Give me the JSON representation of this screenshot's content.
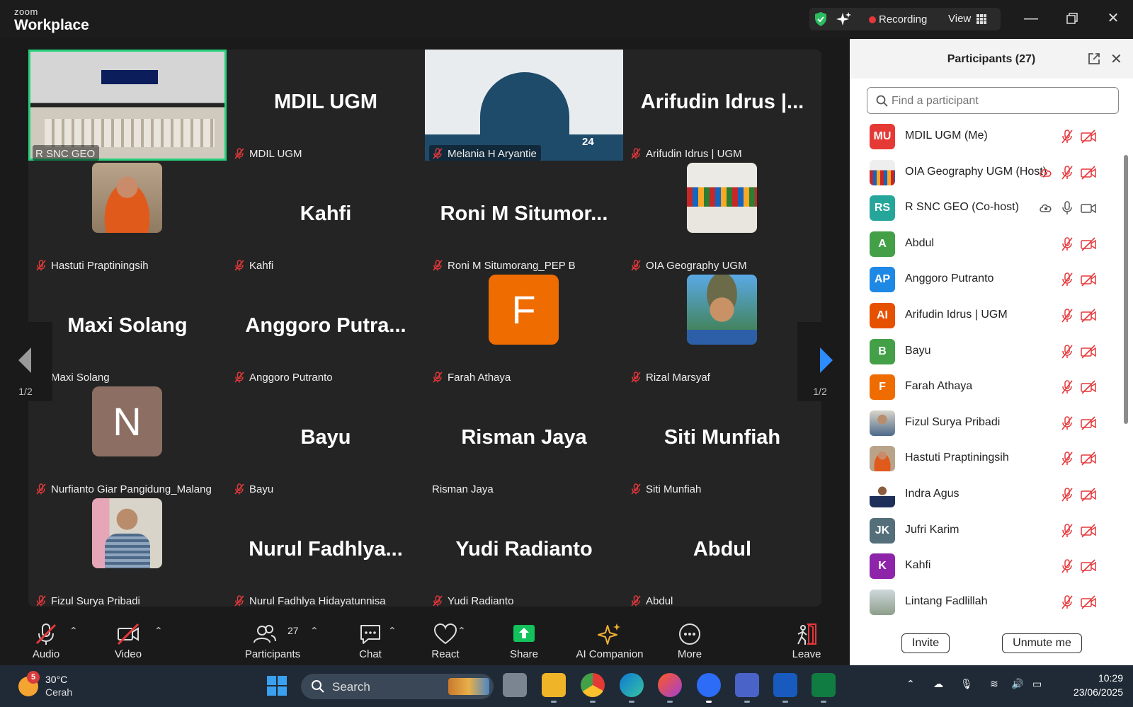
{
  "titlebar": {
    "brand_small": "zoom",
    "brand_big": "Workplace",
    "recording_label": "Recording",
    "view_label": "View"
  },
  "grid": {
    "page_left": "1/2",
    "page_right": "1/2",
    "tiles": [
      {
        "name": "R SNC GEO",
        "kind": "room",
        "muted": false,
        "active": true
      },
      {
        "name": "MDIL UGM",
        "display": "MDIL UGM",
        "kind": "text",
        "muted": true
      },
      {
        "name": "Melania H Aryantie",
        "kind": "slide",
        "muted": true
      },
      {
        "name": "Arifudin Idrus | UGM",
        "display": "Arifudin Idrus |...",
        "kind": "text",
        "muted": true
      },
      {
        "name": "Hastuti Praptiningsih",
        "kind": "photo-orange",
        "muted": true
      },
      {
        "name": "Kahfi",
        "display": "Kahfi",
        "kind": "text",
        "muted": true
      },
      {
        "name": "Roni M Situmorang_PEP B",
        "display": "Roni M Situmor...",
        "kind": "text",
        "muted": true
      },
      {
        "name": "OIA Geography UGM",
        "kind": "photo-flags",
        "muted": true
      },
      {
        "name": "Maxi Solang",
        "display": "Maxi Solang",
        "kind": "text",
        "muted": true
      },
      {
        "name": "Anggoro Putranto",
        "display": "Anggoro Putra...",
        "kind": "text",
        "muted": true
      },
      {
        "name": "Farah Athaya",
        "kind": "letter",
        "letter": "F",
        "color": "#ef6c00",
        "muted": true
      },
      {
        "name": "Rizal Marsyaf",
        "kind": "photo-hat",
        "muted": true
      },
      {
        "name": "Nurfianto Giar Pangidung_Malang",
        "kind": "letter",
        "letter": "N",
        "color": "#8d6e63",
        "muted": true
      },
      {
        "name": "Bayu",
        "display": "Bayu",
        "kind": "text",
        "muted": true
      },
      {
        "name": "Risman Jaya",
        "display": "Risman Jaya",
        "kind": "text",
        "muted": false
      },
      {
        "name": "Siti Munfiah",
        "display": "Siti Munfiah",
        "kind": "text",
        "muted": true
      },
      {
        "name": "Fizul Surya Pribadi",
        "kind": "photo-man",
        "muted": true
      },
      {
        "name": "Nurul Fadhlya Hidayatunnisa",
        "display": "Nurul Fadhlya...",
        "kind": "text",
        "muted": true
      },
      {
        "name": "Yudi Radianto",
        "display": "Yudi Radianto",
        "kind": "text",
        "muted": true
      },
      {
        "name": "Abdul",
        "display": "Abdul",
        "kind": "text",
        "muted": true
      }
    ],
    "slide": {
      "date_number": "24"
    }
  },
  "panel": {
    "title": "Participants (27)",
    "search_placeholder": "Find a participant",
    "invite_label": "Invite",
    "unmute_label": "Unmute me",
    "participants": [
      {
        "name": "MDIL UGM (Me)",
        "initials": "MU",
        "color": "#e53935",
        "cloud": false,
        "mic_on": false,
        "video_on": false
      },
      {
        "name": "OIA Geography UGM (Host)",
        "initials": "",
        "photo": "flags",
        "cloud": true,
        "cloud_red": true,
        "mic_on": false,
        "video_on": false
      },
      {
        "name": "R SNC GEO (Co-host)",
        "initials": "RS",
        "color": "#26a69a",
        "cloud": true,
        "cloud_red": false,
        "mic_on": true,
        "video_on": true
      },
      {
        "name": "Abdul",
        "initials": "A",
        "color": "#43a047",
        "mic_on": false,
        "video_on": false
      },
      {
        "name": "Anggoro Putranto",
        "initials": "AP",
        "color": "#1e88e5",
        "mic_on": false,
        "video_on": false
      },
      {
        "name": "Arifudin Idrus | UGM",
        "initials": "AI",
        "color": "#e65100",
        "mic_on": false,
        "video_on": false
      },
      {
        "name": "Bayu",
        "initials": "B",
        "color": "#43a047",
        "mic_on": false,
        "video_on": false
      },
      {
        "name": "Farah Athaya",
        "initials": "F",
        "color": "#ef6c00",
        "mic_on": false,
        "video_on": false
      },
      {
        "name": "Fizul Surya Pribadi",
        "initials": "",
        "photo": "man",
        "mic_on": false,
        "video_on": false
      },
      {
        "name": "Hastuti Praptiningsih",
        "initials": "",
        "photo": "orange",
        "mic_on": false,
        "video_on": false
      },
      {
        "name": "Indra Agus",
        "initials": "",
        "photo": "suit",
        "mic_on": false,
        "video_on": false
      },
      {
        "name": "Jufri Karim",
        "initials": "JK",
        "color": "#546e7a",
        "mic_on": false,
        "video_on": false
      },
      {
        "name": "Kahfi",
        "initials": "K",
        "color": "#8e24aa",
        "mic_on": false,
        "video_on": false
      },
      {
        "name": "Lintang Fadlillah",
        "initials": "",
        "photo": "scene",
        "mic_on": false,
        "video_on": false
      }
    ]
  },
  "toolbar": {
    "audio": "Audio",
    "video": "Video",
    "participants": "Participants",
    "participants_count": "27",
    "chat": "Chat",
    "react": "React",
    "share": "Share",
    "ai": "AI Companion",
    "more": "More",
    "leave": "Leave"
  },
  "taskbar": {
    "weather_badge": "5",
    "temp": "30°C",
    "condition": "Cerah",
    "search_label": "Search",
    "time": "10:29",
    "date": "23/06/2025"
  }
}
